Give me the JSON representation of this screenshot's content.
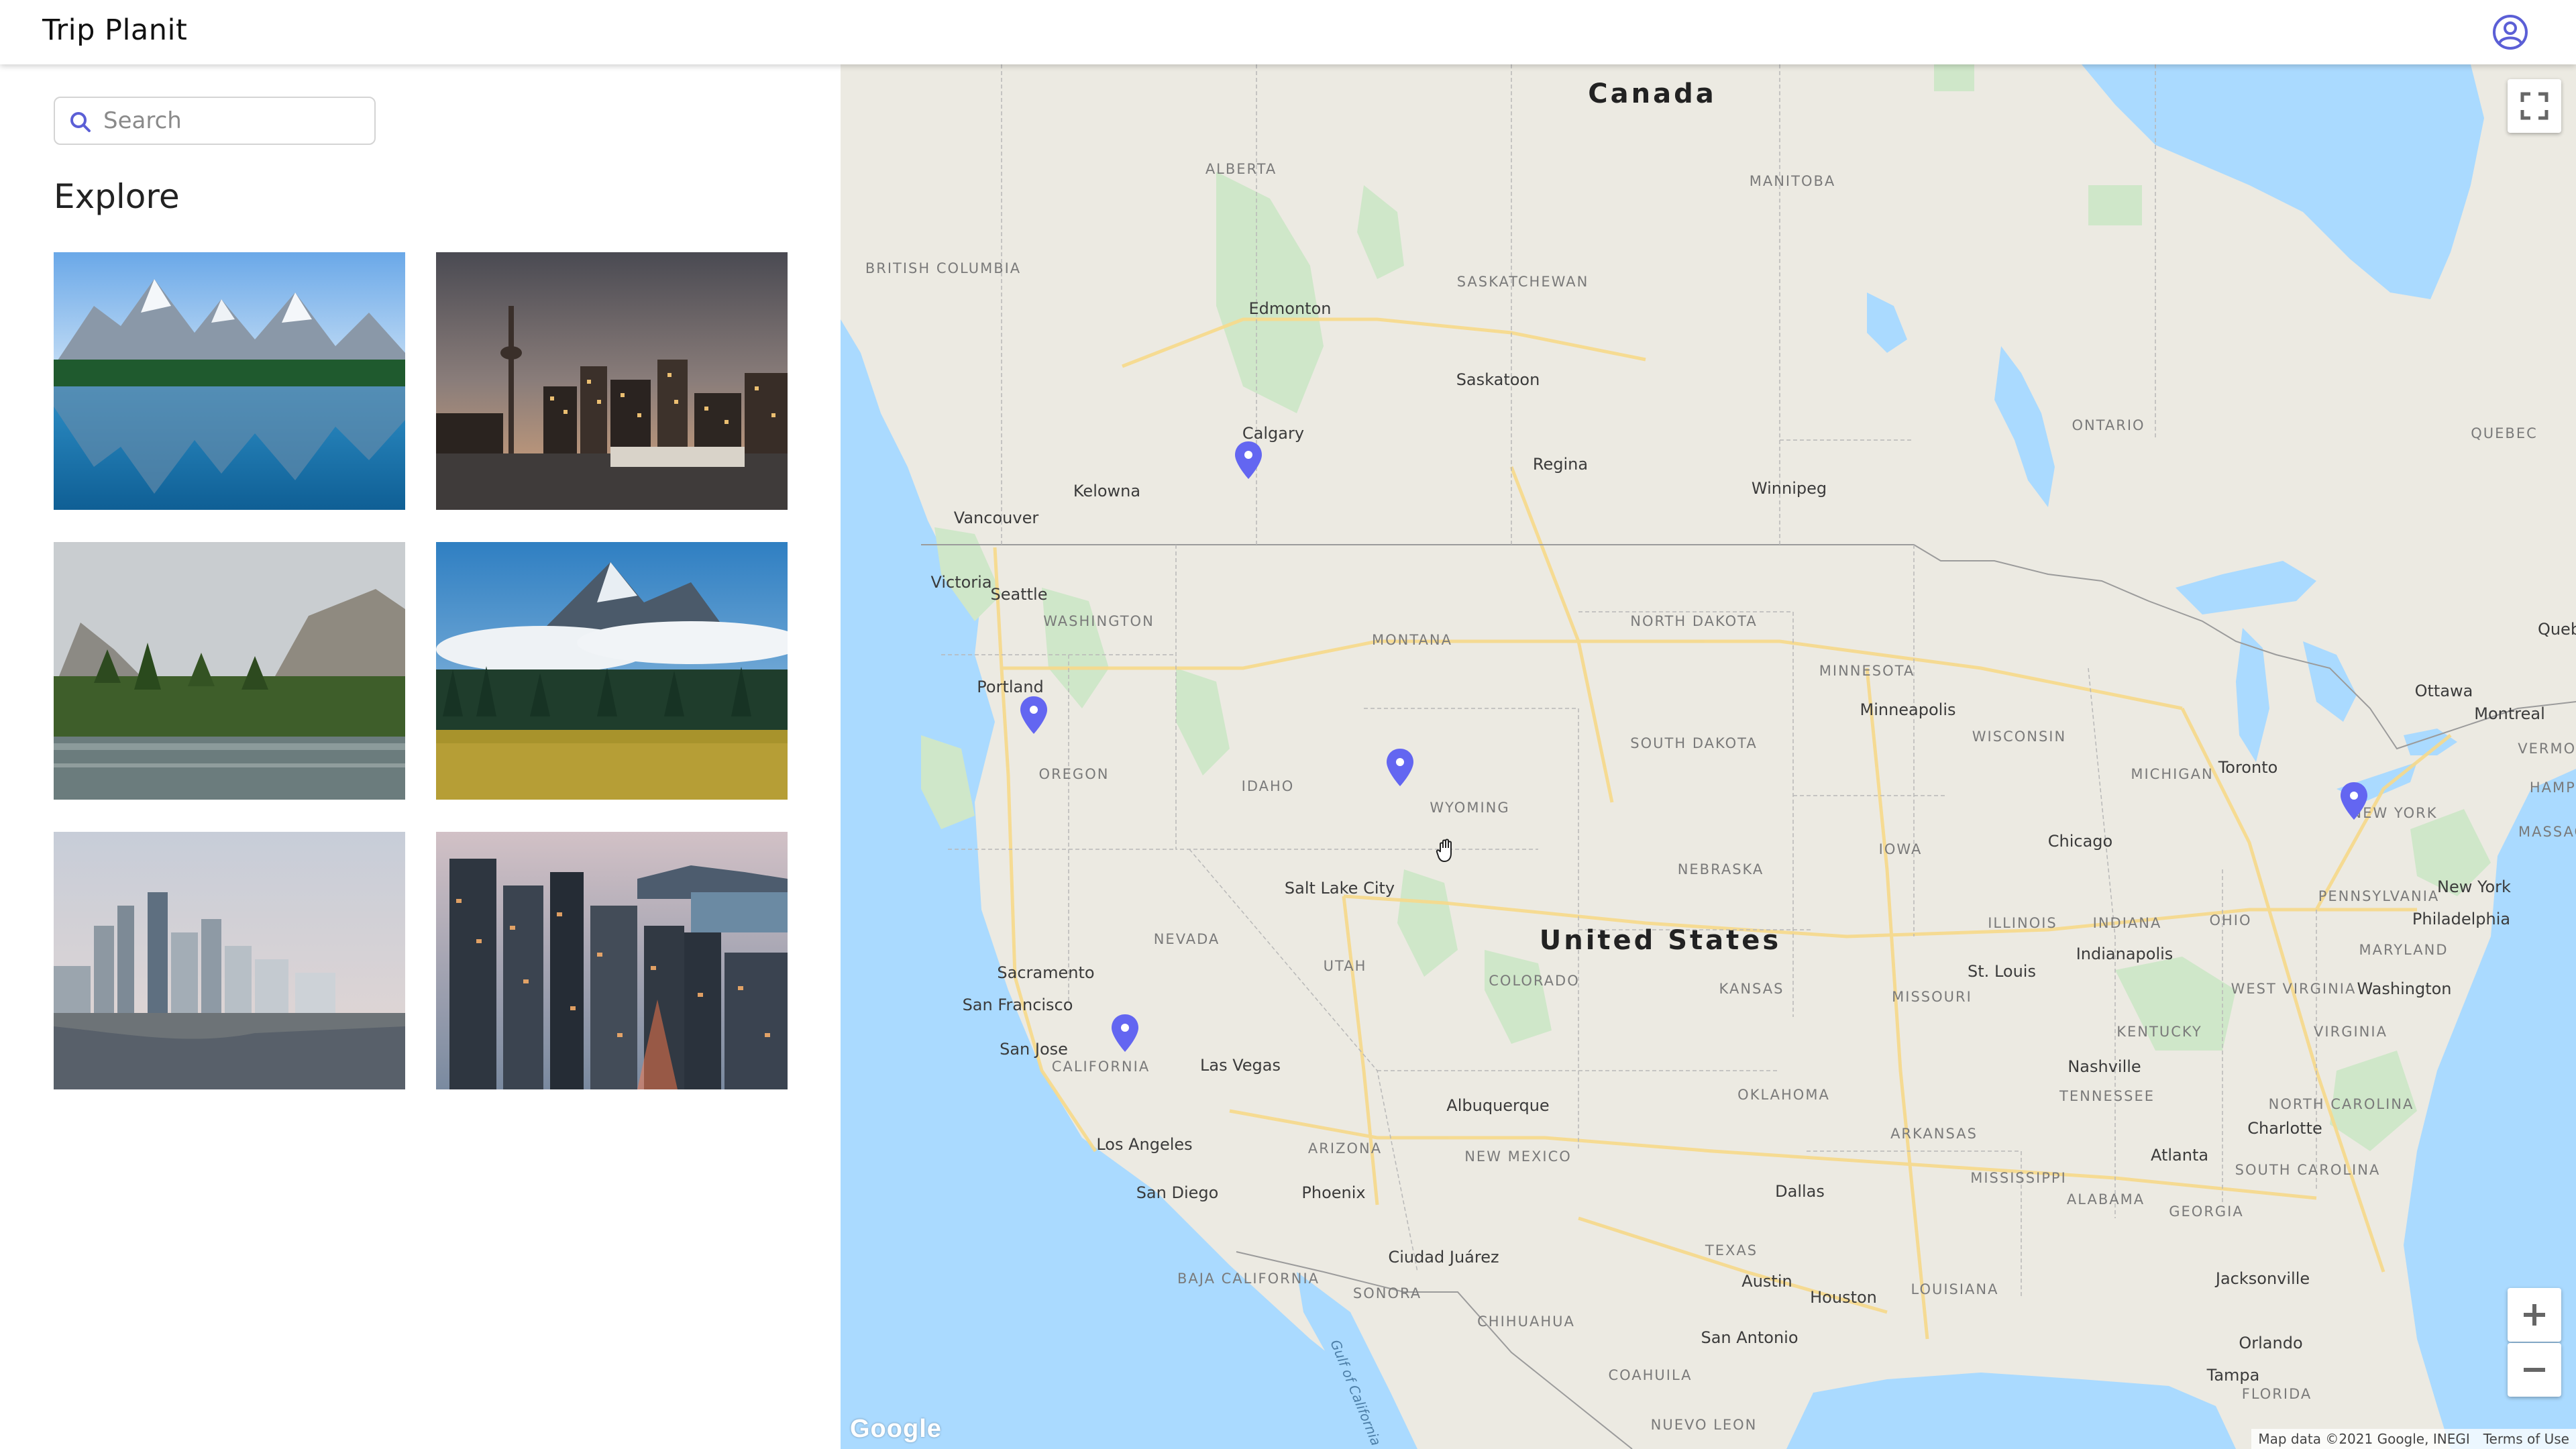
{
  "header": {
    "title": "Trip Planit",
    "user_icon": "account-circle-icon"
  },
  "sidebar": {
    "search": {
      "placeholder": "Search",
      "value": ""
    },
    "explore_title": "Explore",
    "tiles": [
      {
        "scene": "mountain-lake-reflection"
      },
      {
        "scene": "city-skyline-tower-dusk"
      },
      {
        "scene": "valley-river-cliffs"
      },
      {
        "scene": "mountain-clouds-forest"
      },
      {
        "scene": "waterfront-skyline"
      },
      {
        "scene": "aerial-downtown-dusk"
      }
    ]
  },
  "map": {
    "countries": [
      "Canada",
      "United States"
    ],
    "provinces": [
      "ALBERTA",
      "BRITISH COLUMBIA",
      "SASKATCHEWAN",
      "MANITOBA",
      "ONTARIO",
      "QUEBEC"
    ],
    "states": [
      "WASHINGTON",
      "OREGON",
      "IDAHO",
      "MONTANA",
      "WYOMING",
      "NORTH DAKOTA",
      "SOUTH DAKOTA",
      "NEBRASKA",
      "NEVADA",
      "UTAH",
      "COLORADO",
      "KANSAS",
      "CALIFORNIA",
      "ARIZONA",
      "NEW MEXICO",
      "OKLAHOMA",
      "TEXAS",
      "MINNESOTA",
      "WISCONSIN",
      "IOWA",
      "MISSOURI",
      "ILLINOIS",
      "MICHIGAN",
      "INDIANA",
      "OHIO",
      "KENTUCKY",
      "TENNESSEE",
      "ARKANSAS",
      "MISSISSIPPI",
      "ALABAMA",
      "GEORGIA",
      "LOUISIANA",
      "NEW YORK",
      "PENNSYLVANIA",
      "WEST VIRGINIA",
      "VIRGINIA",
      "NORTH CAROLINA",
      "SOUTH CAROLINA",
      "MARYLAND",
      "VERMONT",
      "HAMPS",
      "MASSACH",
      "FLORIDA",
      "BAJA CALIFORNIA",
      "SONORA",
      "CHIHUAHUA",
      "COAHUILA",
      "NUEVO LEON"
    ],
    "cities": [
      "Edmonton",
      "Calgary",
      "Kelowna",
      "Vancouver",
      "Victoria",
      "Saskatoon",
      "Regina",
      "Winnipeg",
      "Seattle",
      "Portland",
      "Salt Lake City",
      "Sacramento",
      "San Francisco",
      "San Jose",
      "Las Vegas",
      "Los Angeles",
      "San Diego",
      "Phoenix",
      "Albuquerque",
      "Ciudad Juárez",
      "Minneapolis",
      "Chicago",
      "Indianapolis",
      "St. Louis",
      "Nashville",
      "Atlanta",
      "Charlotte",
      "Dallas",
      "Austin",
      "Houston",
      "San Antonio",
      "Jacksonville",
      "Orlando",
      "Tampa",
      "Toronto",
      "Ottawa",
      "Montreal",
      "Queb",
      "New York",
      "Philadelphia",
      "Washington"
    ],
    "water": [
      "Gulf of California"
    ],
    "pins": [
      {
        "place": "Calgary"
      },
      {
        "place": "Portland"
      },
      {
        "place": "Wyoming"
      },
      {
        "place": "California"
      },
      {
        "place": "Toronto"
      }
    ],
    "google_logo": "Google",
    "attribution": "Map data ©2021 Google, INEGI",
    "terms": "Terms of Use",
    "controls": {
      "fullscreen": "fullscreen-icon",
      "zoom_in": "+",
      "zoom_out": "−"
    },
    "colors": {
      "water": "#aadaff",
      "land": "#eceae2",
      "park": "#cfe7c9",
      "highway": "#f7d98a",
      "pin": "#6366f1"
    }
  }
}
